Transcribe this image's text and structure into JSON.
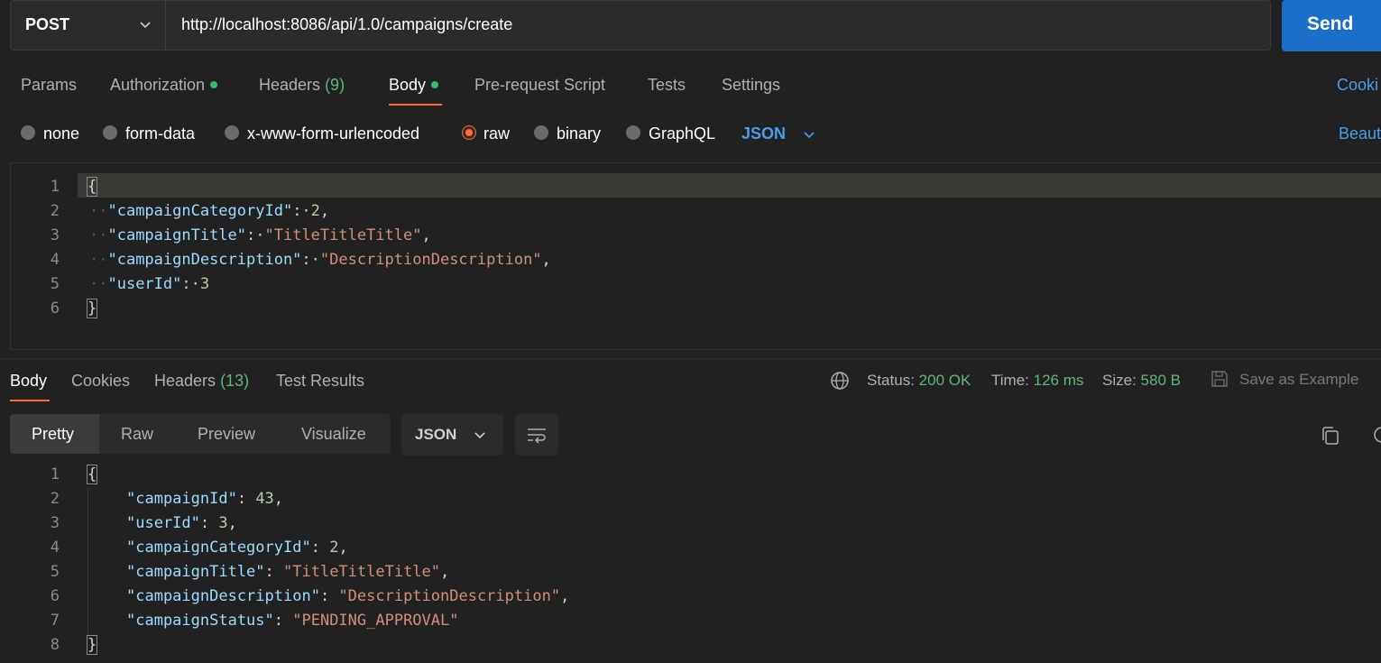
{
  "request": {
    "method": "POST",
    "url": "http://localhost:8086/api/1.0/campaigns/create",
    "send_label": "Send"
  },
  "request_tabs": {
    "params": "Params",
    "authorization": "Authorization",
    "headers": "Headers",
    "headers_count": "(9)",
    "body": "Body",
    "prerequest": "Pre-request Script",
    "tests": "Tests",
    "settings": "Settings",
    "cookies": "Cooki"
  },
  "body_types": {
    "none": "none",
    "form_data": "form-data",
    "urlencoded": "x-www-form-urlencoded",
    "raw": "raw",
    "binary": "binary",
    "graphql": "GraphQL",
    "selected": "raw",
    "format": "JSON",
    "beautify": "Beaut"
  },
  "request_body": {
    "line_numbers": [
      "1",
      "2",
      "3",
      "4",
      "5",
      "6"
    ],
    "open": "{",
    "close": "}",
    "k1": "\"campaignCategoryId\"",
    "v1": "2",
    "k2": "\"campaignTitle\"",
    "v2": "\"TitleTitleTitle\"",
    "k3": "\"campaignDescription\"",
    "v3": "\"DescriptionDescription\"",
    "k4": "\"userId\"",
    "v4": "3"
  },
  "response_tabs": {
    "body": "Body",
    "cookies": "Cookies",
    "headers": "Headers",
    "headers_count": "(13)",
    "test_results": "Test Results"
  },
  "response_status": {
    "status_label": "Status:",
    "status_value": "200 OK",
    "time_label": "Time:",
    "time_value": "126 ms",
    "size_label": "Size:",
    "size_value": "580 B",
    "save_example": "Save as Example"
  },
  "response_view": {
    "pretty": "Pretty",
    "raw": "Raw",
    "preview": "Preview",
    "visualize": "Visualize",
    "format": "JSON"
  },
  "response_body": {
    "line_numbers": [
      "1",
      "2",
      "3",
      "4",
      "5",
      "6",
      "7",
      "8"
    ],
    "open": "{",
    "close": "}",
    "k1": "\"campaignId\"",
    "v1": "43",
    "k2": "\"userId\"",
    "v2": "3",
    "k3": "\"campaignCategoryId\"",
    "v3": "2",
    "k4": "\"campaignTitle\"",
    "v4": "\"TitleTitleTitle\"",
    "k5": "\"campaignDescription\"",
    "v5": "\"DescriptionDescription\"",
    "k6": "\"campaignStatus\"",
    "v6": "\"PENDING_APPROVAL\""
  },
  "colors": {
    "accent": "#ff6c37",
    "send": "#1c6fc9",
    "success": "#5fb778",
    "link": "#4a9ee8"
  },
  "icons": [
    "chevron-down-icon",
    "globe-icon",
    "save-icon",
    "wrap-lines-icon",
    "copy-icon",
    "search-icon"
  ]
}
